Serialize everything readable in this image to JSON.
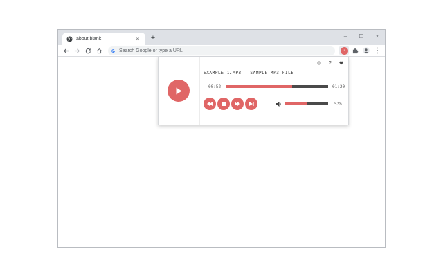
{
  "browser": {
    "tab": {
      "title": "about:blank",
      "close_glyph": "×",
      "icon": "globe-icon"
    },
    "new_tab_glyph": "+",
    "window_controls": {
      "minimize": "–",
      "maximize": "☐",
      "close": "×"
    },
    "omnibox": {
      "placeholder": "Search Google or type a URL",
      "icon": "google-g-icon"
    },
    "extension_badge": "♪"
  },
  "player": {
    "filename": "EXAMPLE-1.MP3 - SAMPLE MP3 FILE",
    "current_time": "00:52",
    "total_time": "01:20",
    "progress_fraction": 0.65,
    "volume_percent": 52,
    "volume_label": "52%",
    "top_icons": [
      "settings-icon",
      "help-icon",
      "heart-icon"
    ],
    "controls": [
      "rewind-icon",
      "stop-icon",
      "fast-forward-icon",
      "skip-next-icon"
    ],
    "accent_color": "#e06666",
    "track_color": "#4a4a4a"
  }
}
